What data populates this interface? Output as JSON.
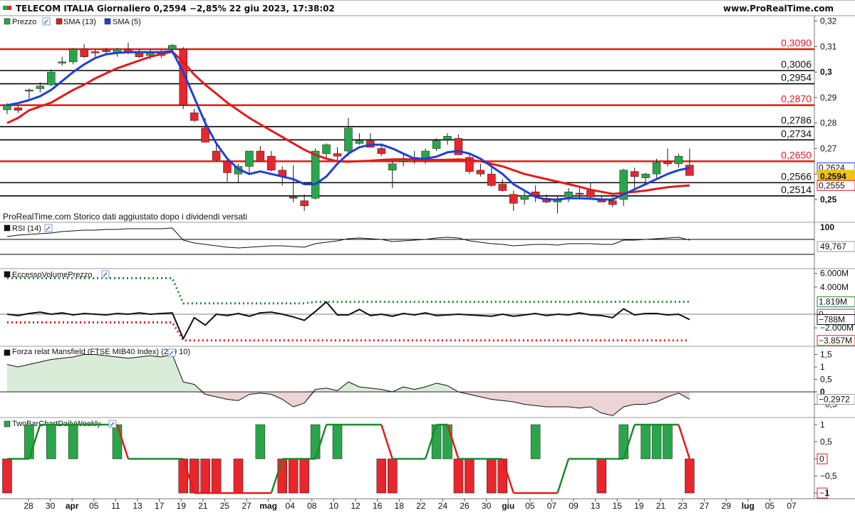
{
  "header": {
    "title": "TELECOM ITALIA Giornaliero 0,2594 −2,85% 22 giu 2023, 17:38:02",
    "brand": "www.ProRealTime.com",
    "note": "ProRealTime.com Storico dati aggiustato dopo i dividendi versati"
  },
  "colors": {
    "up": "#2aa64a",
    "down": "#e8262c",
    "sma13": "#e31a1a",
    "sma5": "#1f3fd6",
    "level_red": "#e31a1a",
    "level_black": "#000000",
    "highlight": "#f2c21b"
  },
  "chart_data": [
    {
      "type": "candlestick",
      "panel": "price",
      "title": "TELECOM ITALIA Giornaliero",
      "legend": [
        "Prezzo",
        "SMA (13)",
        "SMA (5)"
      ],
      "ylim": [
        0.2345,
        0.3226
      ],
      "y_ticks": [
        0.25,
        0.26,
        0.27,
        0.28,
        0.29,
        0.3,
        0.31,
        0.32
      ],
      "y_tick_labels": [
        "0,25",
        "0,26",
        "0,27",
        "0,28",
        "0,29",
        "0,3",
        "0,31",
        "0,32"
      ],
      "levels": [
        {
          "value": 0.309,
          "label": "0,3090",
          "color": "red"
        },
        {
          "value": 0.3006,
          "label": "0,3006",
          "color": "black"
        },
        {
          "value": 0.2954,
          "label": "0,2954",
          "color": "black"
        },
        {
          "value": 0.287,
          "label": "0,2870",
          "color": "red"
        },
        {
          "value": 0.2786,
          "label": "0,2786",
          "color": "black"
        },
        {
          "value": 0.2734,
          "label": "0,2734",
          "color": "black"
        },
        {
          "value": 0.265,
          "label": "0,2650",
          "color": "red"
        },
        {
          "value": 0.2566,
          "label": "0,2566",
          "color": "black"
        },
        {
          "value": 0.2514,
          "label": "0,2514",
          "color": "black"
        }
      ],
      "last_values": [
        {
          "value": 0.2624,
          "label": "0,2624",
          "series": "SMA (5)"
        },
        {
          "value": 0.2594,
          "label": "0,2594",
          "series": "Prezzo"
        },
        {
          "value": 0.2555,
          "label": "0,2555",
          "series": "SMA (13)"
        }
      ],
      "ohlc": [
        [
          0.2852,
          0.2878,
          0.2835,
          0.287
        ],
        [
          0.286,
          0.2868,
          0.284,
          0.285
        ],
        [
          0.2925,
          0.2935,
          0.2895,
          0.293
        ],
        [
          0.2935,
          0.296,
          0.292,
          0.2945
        ],
        [
          0.295,
          0.301,
          0.2945,
          0.3
        ],
        [
          0.3035,
          0.306,
          0.3025,
          0.304
        ],
        [
          0.304,
          0.3095,
          0.303,
          0.309
        ],
        [
          0.309,
          0.311,
          0.3055,
          0.306
        ],
        [
          0.308,
          0.309,
          0.306,
          0.3075
        ],
        [
          0.3085,
          0.3095,
          0.307,
          0.308
        ],
        [
          0.3075,
          0.3095,
          0.306,
          0.309
        ],
        [
          0.309,
          0.3115,
          0.307,
          0.308
        ],
        [
          0.308,
          0.309,
          0.3055,
          0.306
        ],
        [
          0.3065,
          0.309,
          0.305,
          0.308
        ],
        [
          0.3075,
          0.3088,
          0.3055,
          0.3065
        ],
        [
          0.309,
          0.311,
          0.307,
          0.3105
        ],
        [
          0.309,
          0.3098,
          0.2855,
          0.287
        ],
        [
          0.284,
          0.2855,
          0.2805,
          0.281
        ],
        [
          0.278,
          0.282,
          0.2725,
          0.2725
        ],
        [
          0.269,
          0.272,
          0.265,
          0.2655
        ],
        [
          0.265,
          0.266,
          0.257,
          0.2605
        ],
        [
          0.26,
          0.264,
          0.2565,
          0.263
        ],
        [
          0.263,
          0.269,
          0.26,
          0.269
        ],
        [
          0.269,
          0.271,
          0.2655,
          0.265
        ],
        [
          0.267,
          0.269,
          0.261,
          0.2615
        ],
        [
          0.2615,
          0.263,
          0.2555,
          0.259
        ],
        [
          0.251,
          0.2635,
          0.249,
          0.2505
        ],
        [
          0.2495,
          0.252,
          0.2455,
          0.2475
        ],
        [
          0.2505,
          0.27,
          0.25,
          0.269
        ],
        [
          0.268,
          0.272,
          0.266,
          0.2715
        ],
        [
          0.268,
          0.2705,
          0.265,
          0.267
        ],
        [
          0.269,
          0.282,
          0.267,
          0.278
        ],
        [
          0.272,
          0.276,
          0.2715,
          0.273
        ],
        [
          0.273,
          0.276,
          0.271,
          0.2705
        ],
        [
          0.27,
          0.272,
          0.267,
          0.268
        ],
        [
          0.2615,
          0.266,
          0.2545,
          0.264
        ],
        [
          0.265,
          0.268,
          0.263,
          0.266
        ],
        [
          0.2665,
          0.269,
          0.264,
          0.2655
        ],
        [
          0.266,
          0.27,
          0.264,
          0.269
        ],
        [
          0.27,
          0.274,
          0.269,
          0.273
        ],
        [
          0.2735,
          0.276,
          0.2715,
          0.2748
        ],
        [
          0.274,
          0.2755,
          0.272,
          0.2675
        ],
        [
          0.2665,
          0.2675,
          0.26,
          0.261
        ],
        [
          0.2615,
          0.264,
          0.259,
          0.26
        ],
        [
          0.26,
          0.2625,
          0.255,
          0.2555
        ],
        [
          0.256,
          0.258,
          0.253,
          0.2535
        ],
        [
          0.252,
          0.2535,
          0.2455,
          0.2485
        ],
        [
          0.25,
          0.253,
          0.248,
          0.2515
        ],
        [
          0.253,
          0.2555,
          0.249,
          0.2515
        ],
        [
          0.2505,
          0.252,
          0.2485,
          0.249
        ],
        [
          0.249,
          0.2515,
          0.2445,
          0.25
        ],
        [
          0.251,
          0.2545,
          0.249,
          0.253
        ],
        [
          0.2525,
          0.2545,
          0.25,
          0.252
        ],
        [
          0.2535,
          0.2565,
          0.25,
          0.251
        ],
        [
          0.25,
          0.2515,
          0.249,
          0.249
        ],
        [
          0.2495,
          0.251,
          0.247,
          0.248
        ],
        [
          0.25,
          0.262,
          0.2475,
          0.2615
        ],
        [
          0.261,
          0.2625,
          0.254,
          0.259
        ],
        [
          0.2585,
          0.2605,
          0.2555,
          0.26
        ],
        [
          0.26,
          0.266,
          0.2585,
          0.2645
        ],
        [
          0.265,
          0.27,
          0.263,
          0.264
        ],
        [
          0.264,
          0.268,
          0.2625,
          0.267
        ],
        [
          0.2635,
          0.27,
          0.26,
          0.2594
        ]
      ],
      "sma13": [
        0.28,
        0.282,
        0.285,
        0.2865,
        0.288,
        0.2905,
        0.293,
        0.295,
        0.2975,
        0.2995,
        0.3015,
        0.303,
        0.3045,
        0.306,
        0.307,
        0.308,
        0.304,
        0.299,
        0.295,
        0.2915,
        0.288,
        0.285,
        0.282,
        0.2795,
        0.277,
        0.2745,
        0.272,
        0.2695,
        0.2675,
        0.266,
        0.265,
        0.2648,
        0.265,
        0.2652,
        0.2655,
        0.2657,
        0.2658,
        0.2657,
        0.2655,
        0.2655,
        0.2656,
        0.2657,
        0.2655,
        0.265,
        0.264,
        0.263,
        0.2615,
        0.26,
        0.259,
        0.258,
        0.257,
        0.256,
        0.255,
        0.2538,
        0.253,
        0.2522,
        0.2525,
        0.253,
        0.2535,
        0.2542,
        0.2548,
        0.2552,
        0.2555
      ],
      "sma5": [
        0.287,
        0.2878,
        0.289,
        0.2905,
        0.293,
        0.2965,
        0.3,
        0.303,
        0.3055,
        0.307,
        0.3075,
        0.3078,
        0.3078,
        0.3078,
        0.3078,
        0.3082,
        0.3,
        0.29,
        0.28,
        0.272,
        0.266,
        0.262,
        0.26,
        0.261,
        0.26,
        0.259,
        0.258,
        0.256,
        0.256,
        0.259,
        0.264,
        0.268,
        0.2705,
        0.2715,
        0.2715,
        0.27,
        0.268,
        0.266,
        0.266,
        0.2668,
        0.2685,
        0.269,
        0.268,
        0.266,
        0.263,
        0.26,
        0.256,
        0.2535,
        0.251,
        0.25,
        0.25,
        0.2505,
        0.2505,
        0.2503,
        0.25,
        0.25,
        0.252,
        0.254,
        0.256,
        0.258,
        0.26,
        0.2615,
        0.2624
      ]
    },
    {
      "type": "line",
      "panel": "rsi",
      "title": "RSI (14)",
      "ylim": [
        0,
        100
      ],
      "y_tick_labels": [
        "100"
      ],
      "last_value_label": "49,767",
      "values": [
        55,
        57,
        58,
        59,
        60,
        62,
        63,
        64,
        64,
        65,
        65,
        66,
        66,
        66,
        66,
        67,
        50,
        46,
        44,
        42,
        40,
        39,
        40,
        41,
        42,
        42,
        41,
        40,
        45,
        47,
        49,
        52,
        53,
        52,
        51,
        48,
        49,
        50,
        51,
        53,
        54,
        53,
        49,
        47,
        45,
        44,
        42,
        43,
        44,
        44,
        43,
        45,
        45,
        45,
        44,
        44,
        50,
        50,
        51,
        52,
        53,
        54,
        50
      ]
    },
    {
      "type": "line",
      "panel": "volume_excess",
      "title": "EccessoVolumePrezzo",
      "y_tick_labels": [
        "6.000M",
        "4.000M",
        "0",
        "−2.000M"
      ],
      "last_value_labels": [
        "1.819M",
        "0",
        "−788M",
        "−3.857M"
      ],
      "upper_band": [
        5300,
        5300,
        5300,
        5300,
        5300,
        5300,
        5300,
        5300,
        5300,
        5300,
        5300,
        5300,
        5300,
        5300,
        5300,
        5300,
        1600,
        1600,
        1600,
        1600,
        1600,
        1600,
        1600,
        1600,
        1600,
        1600,
        1600,
        1600,
        1819,
        1819,
        1819,
        1819,
        1819,
        1819,
        1819,
        1819,
        1819,
        1819,
        1819,
        1819,
        1819,
        1819,
        1819,
        1819,
        1819,
        1819,
        1819,
        1819,
        1819,
        1819,
        1819,
        1819,
        1819,
        1819,
        1819,
        1819,
        1819,
        1819,
        1819,
        1819,
        1819,
        1819,
        1819
      ],
      "lower_band": [
        -1200,
        -1200,
        -1200,
        -1200,
        -1200,
        -1200,
        -1200,
        -1200,
        -1200,
        -1200,
        -1200,
        -1200,
        -1200,
        -1200,
        -1200,
        -1200,
        -3857,
        -3857,
        -3857,
        -3857,
        -3857,
        -3857,
        -3857,
        -3857,
        -3857,
        -3857,
        -3857,
        -3857,
        -3857,
        -3857,
        -3857,
        -3857,
        -3857,
        -3857,
        -3857,
        -3857,
        -3857,
        -3857,
        -3857,
        -3857,
        -3857,
        -3857,
        -3857,
        -3857,
        -3857,
        -3857,
        -3857,
        -3857,
        -3857,
        -3857,
        -3857,
        -3857,
        -3857,
        -3857,
        -3857,
        -3857,
        -3857,
        -3857,
        -3857,
        -3857,
        -3857,
        -3857,
        -3857
      ],
      "values": [
        0,
        -200,
        100,
        300,
        0,
        200,
        -100,
        100,
        0,
        -100,
        100,
        0,
        200,
        0,
        100,
        200,
        -3600,
        -500,
        -1600,
        0,
        -200,
        100,
        -300,
        200,
        300,
        0,
        -400,
        -900,
        400,
        1800,
        -100,
        -100,
        700,
        -200,
        0,
        -300,
        100,
        -100,
        200,
        -200,
        -100,
        0,
        -100,
        -200,
        -300,
        0,
        -300,
        -100,
        100,
        -200,
        0,
        -100,
        200,
        -100,
        -200,
        -500,
        800,
        -100,
        100,
        100,
        -100,
        0,
        -788
      ]
    },
    {
      "type": "area",
      "panel": "mansfield",
      "title": "Forza relat Mansfield (FTSE MIB40 Index) (200 10)",
      "y_tick_labels": [
        "1,5",
        "1",
        "0,5",
        "0",
        "−0,5"
      ],
      "last_value_label": "−0,2972",
      "values": [
        1.1,
        1.0,
        1.1,
        1.2,
        1.3,
        1.35,
        1.4,
        1.5,
        1.5,
        1.45,
        1.4,
        1.35,
        1.4,
        1.45,
        1.4,
        1.5,
        0.4,
        0.3,
        -0.1,
        -0.2,
        -0.3,
        -0.35,
        -0.1,
        -0.05,
        -0.1,
        -0.3,
        -0.6,
        -0.45,
        0.1,
        0.15,
        0.05,
        0.4,
        0.2,
        0.15,
        0.1,
        0.0,
        0.2,
        0.1,
        0.2,
        0.35,
        0.25,
        0.0,
        -0.1,
        -0.2,
        -0.3,
        -0.35,
        -0.4,
        -0.5,
        -0.55,
        -0.6,
        -0.6,
        -0.6,
        -0.65,
        -0.6,
        -0.85,
        -0.95,
        -0.6,
        -0.5,
        -0.5,
        -0.4,
        -0.2,
        -0.05,
        -0.2972
      ]
    },
    {
      "type": "bar",
      "panel": "twobar",
      "title": "TwoBarChartDailyWeekly",
      "y_tick_labels": [
        "1",
        "0,5",
        "0",
        "−0,5",
        "−1"
      ],
      "last_value_labels": [
        "0",
        "−1"
      ],
      "bars": [
        -1,
        0,
        1,
        0,
        1,
        0,
        1,
        0,
        0,
        0,
        1,
        0,
        0,
        0,
        0,
        0,
        -1,
        -1,
        -1,
        -1,
        0,
        -1,
        0,
        1,
        0,
        -1,
        -1,
        -1,
        1,
        0,
        1,
        0,
        0,
        0,
        -1,
        -1,
        0,
        0,
        0,
        1,
        1,
        -1,
        -1,
        0,
        -1,
        -1,
        0,
        0,
        1,
        0,
        0,
        0,
        0,
        0,
        -1,
        0,
        1,
        0,
        1,
        1,
        1,
        0,
        -1
      ],
      "line": [
        0,
        0,
        0,
        1,
        1,
        1,
        1,
        1,
        1,
        1,
        1,
        0,
        0,
        0,
        0,
        0,
        0,
        -1,
        -1,
        -1,
        -1,
        -1,
        -1,
        -1,
        -1,
        0,
        0,
        0,
        0,
        1,
        1,
        1,
        1,
        1,
        1,
        0,
        0,
        0,
        0,
        1,
        1,
        0,
        0,
        0,
        0,
        0,
        -1,
        -1,
        -1,
        -1,
        -1,
        0,
        0,
        0,
        0,
        0,
        0,
        1,
        1,
        1,
        1,
        1,
        0
      ]
    }
  ],
  "x_axis": {
    "labels": [
      "28",
      "30",
      "apr",
      "05",
      "11",
      "13",
      "17",
      "19",
      "21",
      "25",
      "27",
      "mag",
      "04",
      "08",
      "10",
      "12",
      "16",
      "18",
      "22",
      "24",
      "26",
      "30",
      "giu",
      "05",
      "07",
      "09",
      "13",
      "15",
      "19",
      "21",
      "23",
      "27",
      "29",
      "lug",
      "05",
      "07"
    ],
    "bold_labels": [
      "apr",
      "mag",
      "giu",
      "lug"
    ]
  }
}
